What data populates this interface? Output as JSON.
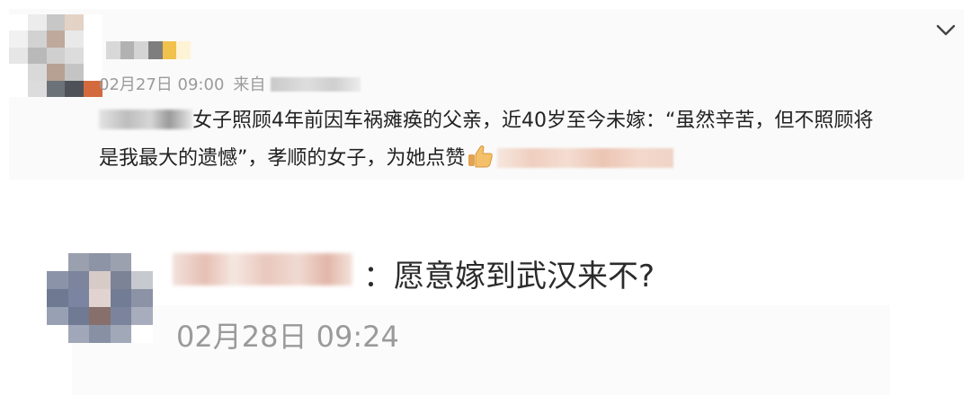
{
  "post": {
    "timestamp": "02月27日 09:00",
    "source_prefix": "来自",
    "body_line1": "女子照顾4年前因车祸瘫痪的父亲，近40岁至今未嫁：“虽然辛苦，但不照顾将",
    "body_line2": "是我最大的遗憾”，孝顺的女子，为她点赞",
    "thumb_icon": "thumbs-up-icon"
  },
  "reply": {
    "separator": "：",
    "text": "愿意嫁到武汉来不?",
    "timestamp": "02月28日 09:24"
  },
  "icons": {
    "menu": "chevron-down-icon"
  }
}
